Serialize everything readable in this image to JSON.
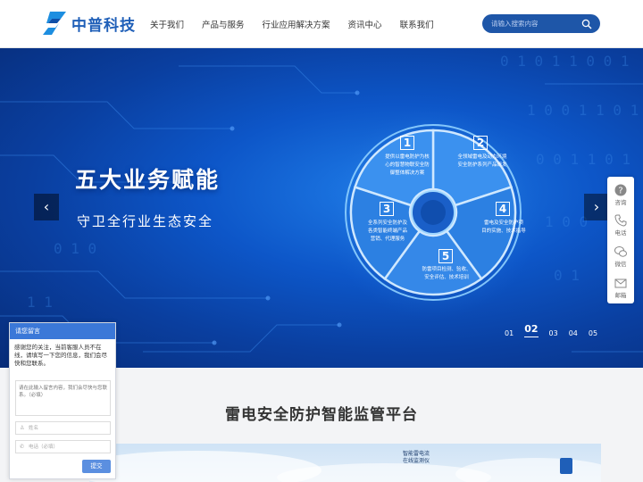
{
  "brand": {
    "name": "中普科技",
    "color": "#1f5fb8"
  },
  "nav": [
    {
      "label": "关于我们"
    },
    {
      "label": "产品与服务"
    },
    {
      "label": "行业应用解决方案"
    },
    {
      "label": "资讯中心"
    },
    {
      "label": "联系我们"
    }
  ],
  "search": {
    "placeholder": "请输入搜索内容",
    "icon": "search-icon"
  },
  "hero": {
    "title": "五大业务赋能",
    "subtitle": "守卫全行业生态安全",
    "segments": [
      {
        "num": "1",
        "text": "提供以雷电防护为核\n心的智慧物联安全防\n御整体解决方案"
      },
      {
        "num": "2",
        "text": "全领域雷电及动力环境\n安全防护系列产品研发"
      },
      {
        "num": "3",
        "text": "全系列安全防护及\n各类智能终端产品\n营销、代理服务"
      },
      {
        "num": "4",
        "text": "雷电及安全防护项\n目的实施、技术指导"
      },
      {
        "num": "5",
        "text": "防雷项目检测、验收、\n安全评估、技术培训"
      }
    ],
    "slides": [
      "01",
      "02",
      "03",
      "04",
      "05"
    ],
    "active_slide": "02",
    "prev_label": "‹",
    "next_label": "›"
  },
  "side": [
    {
      "label": "咨询",
      "icon": "question-icon"
    },
    {
      "label": "电话",
      "icon": "phone-icon"
    },
    {
      "label": "微信",
      "icon": "wechat-icon"
    },
    {
      "label": "邮箱",
      "icon": "mail-icon"
    }
  ],
  "section": {
    "title": "雷电安全防护智能监管平台",
    "preview_label": "智能雷电流\n在线监测仪"
  },
  "chat": {
    "title": "请您留言",
    "message": "感谢您的关注，当前客服人员不在线，请填写一下您的信息，我们会尽快和您联系。",
    "textarea_placeholder": "请在此输入留言内容，我们会尽快与您联系。（必填）",
    "name_placeholder": "姓名",
    "phone_placeholder": "电话（必填）",
    "submit_label": "提交"
  }
}
